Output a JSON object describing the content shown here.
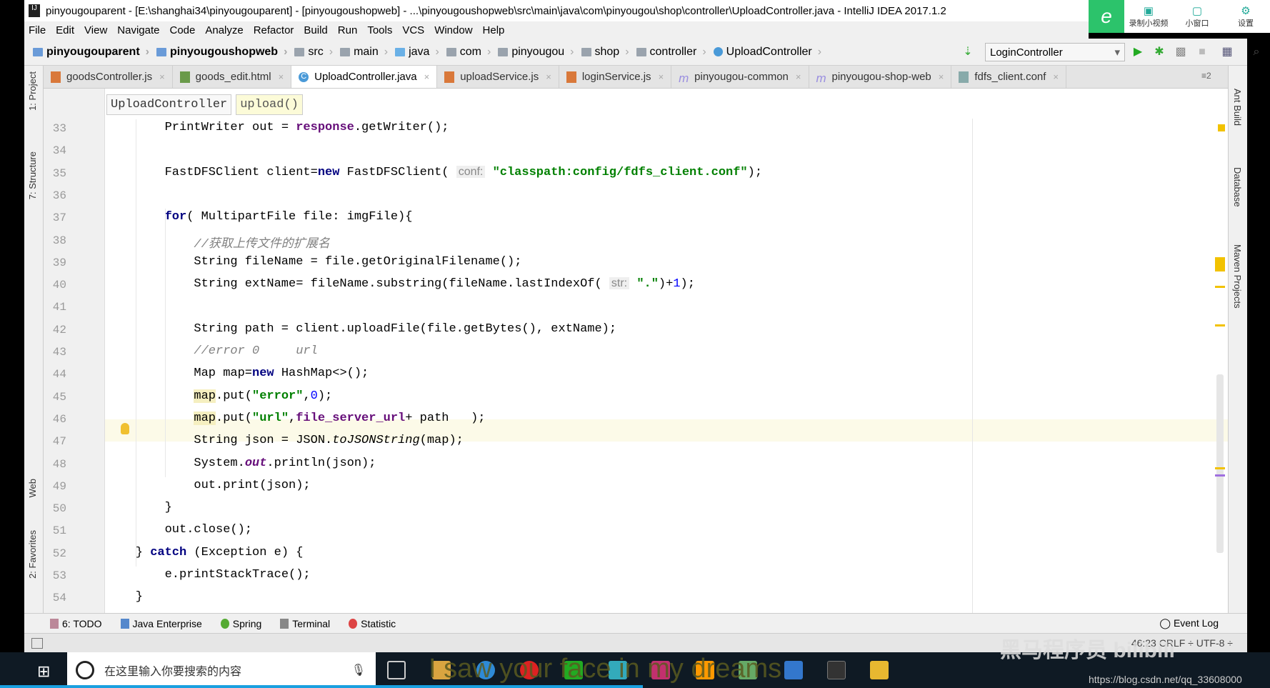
{
  "title": "pinyougouparent - [E:\\shanghai34\\pinyougouparent] - [pinyougoushopweb] - ...\\pinyougoushopweb\\src\\main\\java\\com\\pinyougou\\shop\\controller\\UploadController.java - IntelliJ IDEA 2017.1.2",
  "recorder": {
    "buttons": [
      "录制小视频",
      "小窗口",
      "设置"
    ]
  },
  "menu": [
    "File",
    "Edit",
    "View",
    "Navigate",
    "Code",
    "Analyze",
    "Refactor",
    "Build",
    "Run",
    "Tools",
    "VCS",
    "Window",
    "Help"
  ],
  "nav": {
    "crumbs": [
      "pinyougouparent",
      "pinyougoushopweb",
      "src",
      "main",
      "java",
      "com",
      "pinyougou",
      "shop",
      "controller",
      "UploadController"
    ],
    "run_config": "LoginController"
  },
  "tabs": [
    {
      "label": "goodsController.js",
      "icon": "js-file-icon"
    },
    {
      "label": "goods_edit.html",
      "icon": "html-file-icon"
    },
    {
      "label": "UploadController.java",
      "icon": "java-class-icon",
      "active": true
    },
    {
      "label": "uploadService.js",
      "icon": "js-file-icon"
    },
    {
      "label": "loginService.js",
      "icon": "js-file-icon"
    },
    {
      "label": "pinyougou-common",
      "icon": "maven-icon"
    },
    {
      "label": "pinyougou-shop-web",
      "icon": "maven-icon"
    },
    {
      "label": "fdfs_client.conf",
      "icon": "conf-file-icon"
    }
  ],
  "tabs_overflow": "≡2",
  "editor_breadcrumb": [
    "UploadController",
    "upload()"
  ],
  "left_tools": [
    "1: Project",
    "7: Structure",
    "Web",
    "2: Favorites"
  ],
  "right_tools": [
    "Ant Build",
    "Database",
    "Maven Projects"
  ],
  "code": [
    {
      "n": "33",
      "indent": 8,
      "tokens": [
        [
          "PrintWriter out = ",
          ""
        ],
        [
          "response",
          "fld"
        ],
        [
          ".getWriter();",
          ""
        ]
      ]
    },
    {
      "n": "34",
      "indent": 0,
      "tokens": []
    },
    {
      "n": "35",
      "indent": 8,
      "tokens": [
        [
          "FastDFSClient client=",
          ""
        ],
        [
          "new",
          "kw"
        ],
        [
          " FastDFSClient( ",
          ""
        ],
        [
          "conf:",
          "hint"
        ],
        [
          " ",
          ""
        ],
        [
          "\"classpath:config/fdfs_client.conf\"",
          "str"
        ],
        [
          ");",
          ""
        ]
      ]
    },
    {
      "n": "36",
      "indent": 0,
      "tokens": []
    },
    {
      "n": "37",
      "indent": 8,
      "tokens": [
        [
          "for",
          "kw"
        ],
        [
          "( MultipartFile file: imgFile){",
          ""
        ]
      ]
    },
    {
      "n": "38",
      "indent": 12,
      "tokens": [
        [
          "//获取上传文件的扩展名",
          "cm"
        ]
      ]
    },
    {
      "n": "39",
      "indent": 12,
      "tokens": [
        [
          "String fileName = file.getOriginalFilename();",
          ""
        ]
      ]
    },
    {
      "n": "40",
      "indent": 12,
      "tokens": [
        [
          "String extName= fileName.substring(fileName.lastIndexOf( ",
          ""
        ],
        [
          "str:",
          "hint"
        ],
        [
          " ",
          ""
        ],
        [
          "\".\"",
          "str"
        ],
        [
          ")+",
          ""
        ],
        [
          "1",
          "num"
        ],
        [
          ");",
          ""
        ]
      ]
    },
    {
      "n": "41",
      "indent": 0,
      "tokens": []
    },
    {
      "n": "42",
      "indent": 12,
      "tokens": [
        [
          "String path = client.uploadFile(file.getBytes(), extName);",
          ""
        ]
      ]
    },
    {
      "n": "43",
      "indent": 12,
      "tokens": [
        [
          "//error 0     url",
          "cm"
        ]
      ]
    },
    {
      "n": "44",
      "indent": 12,
      "tokens": [
        [
          "Map map=",
          ""
        ],
        [
          "new",
          "kw"
        ],
        [
          " HashMap<>();",
          ""
        ]
      ]
    },
    {
      "n": "45",
      "indent": 12,
      "tokens": [
        [
          "map",
          "hl"
        ],
        [
          ".put(",
          ""
        ],
        [
          "\"error\"",
          "str"
        ],
        [
          ",",
          ""
        ],
        [
          "0",
          "num"
        ],
        [
          ");",
          ""
        ]
      ]
    },
    {
      "n": "46",
      "indent": 12,
      "tokens": [
        [
          "map",
          "hl"
        ],
        [
          ".put(",
          ""
        ],
        [
          "\"url\"",
          "str"
        ],
        [
          ",",
          ""
        ],
        [
          "file_server_url",
          "fld"
        ],
        [
          "+ path   );",
          ""
        ]
      ]
    },
    {
      "n": "47",
      "indent": 12,
      "tokens": [
        [
          "String json = JSON.",
          ""
        ],
        [
          "toJSONString",
          "it"
        ],
        [
          "(map);",
          ""
        ]
      ]
    },
    {
      "n": "48",
      "indent": 12,
      "tokens": [
        [
          "System.",
          ""
        ],
        [
          "out",
          "fldi"
        ],
        [
          ".println(json);",
          ""
        ]
      ]
    },
    {
      "n": "49",
      "indent": 12,
      "tokens": [
        [
          "out.print(json);",
          ""
        ]
      ]
    },
    {
      "n": "50",
      "indent": 8,
      "tokens": [
        [
          "}",
          ""
        ]
      ]
    },
    {
      "n": "51",
      "indent": 8,
      "tokens": [
        [
          "out.close();",
          ""
        ]
      ]
    },
    {
      "n": "52",
      "indent": 4,
      "tokens": [
        [
          "} ",
          ""
        ],
        [
          "catch",
          "kw"
        ],
        [
          " (Exception e) {",
          ""
        ]
      ]
    },
    {
      "n": "53",
      "indent": 8,
      "tokens": [
        [
          "e.printStackTrace();",
          ""
        ]
      ]
    },
    {
      "n": "54",
      "indent": 4,
      "tokens": [
        [
          "}",
          ""
        ]
      ]
    }
  ],
  "bottom_tools": [
    "6: TODO",
    "Java Enterprise",
    "Spring",
    "Terminal",
    "Statistic"
  ],
  "event_log": "Event Log",
  "status": "46:23   CRLF ÷   UTF-8 ÷",
  "taskbar": {
    "search_placeholder": "在这里输入你要搜索的内容",
    "url": "https://blog.csdn.net/qq_33608000"
  },
  "overlay": {
    "lyric": "I saw your face in my dreams",
    "watermark": "黑马程序员 bilibili"
  }
}
